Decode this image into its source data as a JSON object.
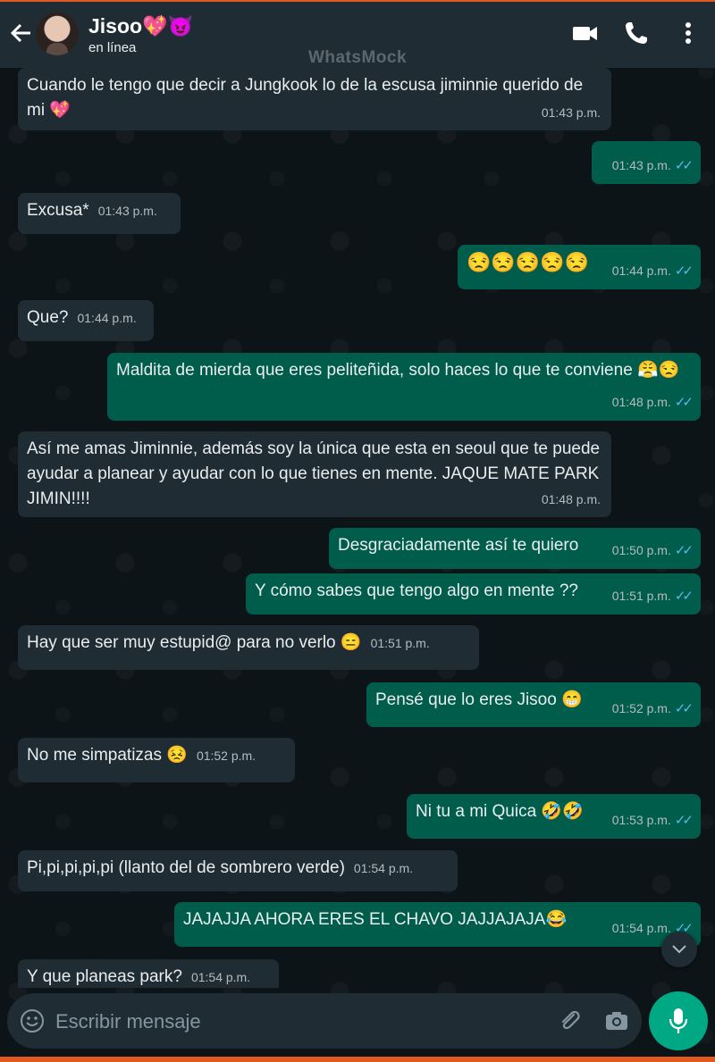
{
  "header": {
    "contact_name": "Jisoo💖😈",
    "status": "en línea",
    "watermark": "WhatsMock"
  },
  "icons": {
    "back": "back-arrow-icon",
    "video": "video-call-icon",
    "call": "phone-icon",
    "menu": "more-options-icon"
  },
  "messages": [
    {
      "direction": "in",
      "text": "Cuando le tengo que decir a Jungkook lo de la escusa jiminnie querido de mi 💖",
      "time": "01:43 p.m."
    },
    {
      "direction": "out",
      "text": "",
      "time": "01:43 p.m.",
      "ticks": "✓✓"
    },
    {
      "direction": "in",
      "text": "Excusa*",
      "time": "01:43 p.m."
    },
    {
      "direction": "out",
      "text": "😒😒😒😒😒",
      "time": "01:44 p.m.",
      "ticks": "✓✓"
    },
    {
      "direction": "in",
      "text": "Que?",
      "time": "01:44 p.m."
    },
    {
      "direction": "out",
      "text": "Maldita de mierda que eres peliteñida, solo haces lo que te conviene 😤😒",
      "time": "01:48 p.m.",
      "ticks": "✓✓"
    },
    {
      "direction": "in",
      "text": "Así me amas Jiminnie, además soy la única que esta en seoul que te puede ayudar a planear y ayudar con lo que tienes en mente. JAQUE MATE PARK JIMIN!!!!",
      "time": "01:48 p.m."
    },
    {
      "direction": "out",
      "text": "Desgraciadamente así te quiero",
      "time": "01:50 p.m.",
      "ticks": "✓✓"
    },
    {
      "direction": "out",
      "text": "Y cómo sabes que tengo algo en mente ??",
      "time": "01:51 p.m.",
      "ticks": "✓✓"
    },
    {
      "direction": "in",
      "text": "Hay que ser muy estupid@ para no verlo 😑",
      "time": "01:51 p.m."
    },
    {
      "direction": "out",
      "text": "Pensé que lo eres Jisoo 😁",
      "time": "01:52 p.m.",
      "ticks": "✓✓"
    },
    {
      "direction": "in",
      "text": "No me simpatizas 😣",
      "time": "01:52 p.m."
    },
    {
      "direction": "out",
      "text": "Ni tu a mi Quica 🤣🤣",
      "time": "01:53 p.m.",
      "ticks": "✓✓"
    },
    {
      "direction": "in",
      "text": "Pi,pi,pi,pi,pi (llanto del de sombrero verde)",
      "time": "01:54 p.m."
    },
    {
      "direction": "out",
      "text": "JAJAJJA AHORA ERES EL CHAVO JAJJAJAJA😂",
      "time": "01:54 p.m.",
      "ticks": "✓✓"
    },
    {
      "direction": "in",
      "text": "Y que planeas park?",
      "time": "01:54 p.m."
    }
  ],
  "composer": {
    "placeholder": "Escribir mensaje",
    "emoji_icon": "emoji-icon",
    "attach_icon": "paperclip-icon",
    "camera_icon": "camera-icon",
    "mic_icon": "microphone-icon"
  },
  "scroll_button_icon": "chevron-down-icon",
  "colors": {
    "header_bg": "#1f2c34",
    "incoming_bubble": "#1f2c34",
    "outgoing_bubble": "#005c4b",
    "read_ticks": "#53bdeb",
    "mic_button": "#00a884",
    "accent_border": "#e05a1f"
  }
}
